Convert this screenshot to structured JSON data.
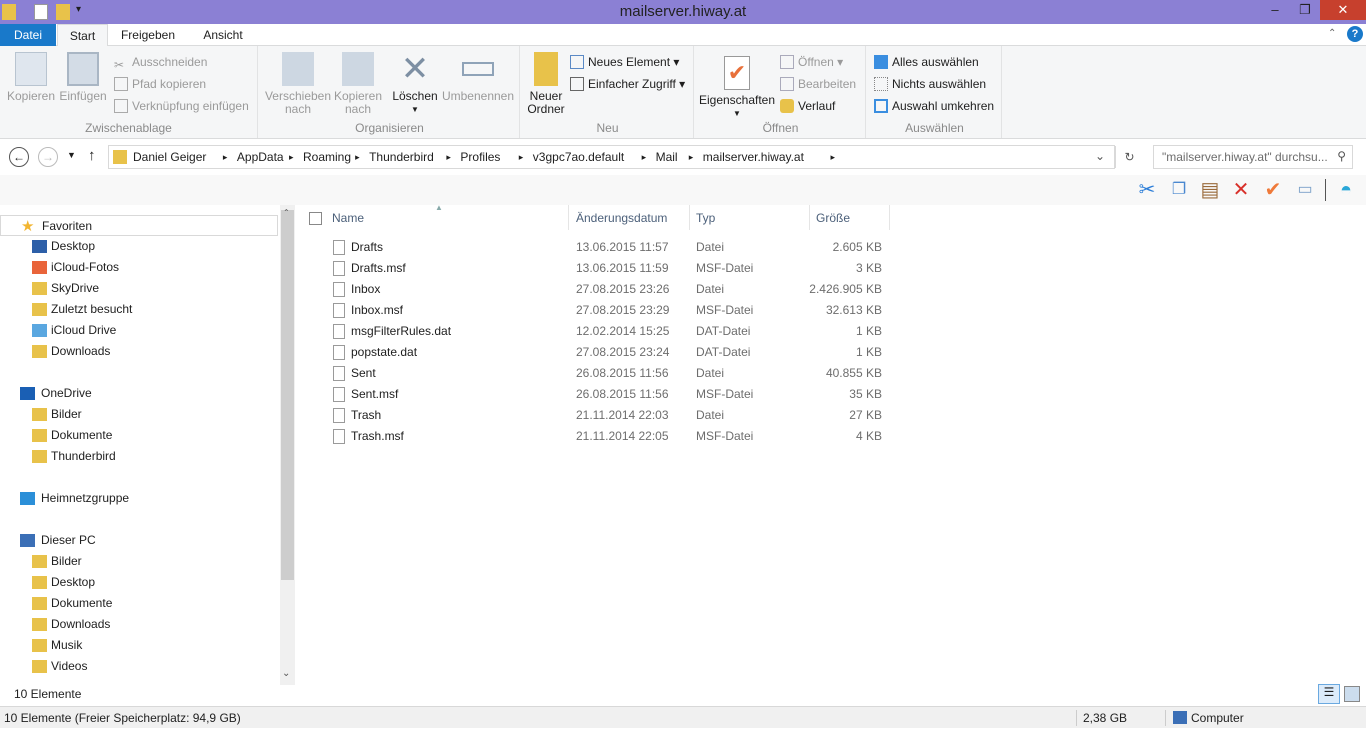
{
  "window": {
    "title": "mailserver.hiway.at",
    "minimize": "–",
    "maximize": "❐",
    "close": "✕"
  },
  "tabs": [
    {
      "label": "Datei"
    },
    {
      "label": "Start"
    },
    {
      "label": "Freigeben"
    },
    {
      "label": "Ansicht"
    }
  ],
  "ribbon": {
    "clipboard": {
      "label": "Zwischenablage",
      "copy": "Kopieren",
      "paste": "Einfügen",
      "cut": "Ausschneiden",
      "copy_path": "Pfad kopieren",
      "paste_shortcut": "Verknüpfung einfügen"
    },
    "organize": {
      "label": "Organisieren",
      "move_to": "Verschieben",
      "move_to2": "nach",
      "copy_to": "Kopieren",
      "copy_to2": "nach",
      "delete": "Löschen",
      "rename": "Umbenennen"
    },
    "new": {
      "label": "Neu",
      "new_folder": "Neuer",
      "new_folder2": "Ordner",
      "new_item": "Neues Element",
      "easy_access": "Einfacher Zugriff"
    },
    "open": {
      "label": "Öffnen",
      "properties": "Eigenschaften",
      "open": "Öffnen",
      "edit": "Bearbeiten",
      "history": "Verlauf"
    },
    "select": {
      "label": "Auswählen",
      "select_all": "Alles auswählen",
      "select_none": "Nichts auswählen",
      "invert": "Auswahl umkehren"
    }
  },
  "breadcrumb": [
    "Daniel Geiger",
    "AppData",
    "Roaming",
    "Thunderbird",
    "Profiles",
    "v3gpc7ao.default",
    "Mail",
    "mailserver.hiway.at"
  ],
  "search": {
    "placeholder": "\"mailserver.hiway.at\" durchsu..."
  },
  "nav": [
    {
      "label": "Favoriten",
      "kind": "star",
      "header": true
    },
    {
      "label": "Desktop",
      "kind": "desktop"
    },
    {
      "label": "iCloud-Fotos",
      "kind": "photos"
    },
    {
      "label": "SkyDrive",
      "kind": "folder"
    },
    {
      "label": "Zuletzt besucht",
      "kind": "folder"
    },
    {
      "label": "iCloud Drive",
      "kind": "cloud"
    },
    {
      "label": "Downloads",
      "kind": "folder"
    },
    {
      "label": "OneDrive",
      "kind": "onedrive",
      "header": true
    },
    {
      "label": "Bilder",
      "kind": "folder"
    },
    {
      "label": "Dokumente",
      "kind": "folder"
    },
    {
      "label": "Thunderbird",
      "kind": "folder"
    },
    {
      "label": "Heimnetzgruppe",
      "kind": "homegroup",
      "header": true
    },
    {
      "label": "Dieser PC",
      "kind": "pc",
      "header": true
    },
    {
      "label": "Bilder",
      "kind": "folder"
    },
    {
      "label": "Desktop",
      "kind": "folder"
    },
    {
      "label": "Dokumente",
      "kind": "folder"
    },
    {
      "label": "Downloads",
      "kind": "folder"
    },
    {
      "label": "Musik",
      "kind": "folder"
    },
    {
      "label": "Videos",
      "kind": "folder"
    }
  ],
  "columns": {
    "name": "Name",
    "date": "Änderungsdatum",
    "type": "Typ",
    "size": "Größe"
  },
  "files": [
    {
      "name": "Drafts",
      "date": "13.06.2015 11:57",
      "type": "Datei",
      "size": "2.605 KB"
    },
    {
      "name": "Drafts.msf",
      "date": "13.06.2015 11:59",
      "type": "MSF-Datei",
      "size": "3 KB"
    },
    {
      "name": "Inbox",
      "date": "27.08.2015 23:26",
      "type": "Datei",
      "size": "2.426.905 KB"
    },
    {
      "name": "Inbox.msf",
      "date": "27.08.2015 23:29",
      "type": "MSF-Datei",
      "size": "32.613 KB"
    },
    {
      "name": "msgFilterRules.dat",
      "date": "12.02.2014 15:25",
      "type": "DAT-Datei",
      "size": "1 KB"
    },
    {
      "name": "popstate.dat",
      "date": "27.08.2015 23:24",
      "type": "DAT-Datei",
      "size": "1 KB"
    },
    {
      "name": "Sent",
      "date": "26.08.2015 11:56",
      "type": "Datei",
      "size": "40.855 KB"
    },
    {
      "name": "Sent.msf",
      "date": "26.08.2015 11:56",
      "type": "MSF-Datei",
      "size": "35 KB"
    },
    {
      "name": "Trash",
      "date": "21.11.2014 22:03",
      "type": "Datei",
      "size": "27 KB"
    },
    {
      "name": "Trash.msf",
      "date": "21.11.2014 22:05",
      "type": "MSF-Datei",
      "size": "4 KB"
    }
  ],
  "item_count": "10 Elemente",
  "status": {
    "left": "10 Elemente (Freier Speicherplatz: 94,9 GB)",
    "size": "2,38 GB",
    "location": "Computer"
  }
}
